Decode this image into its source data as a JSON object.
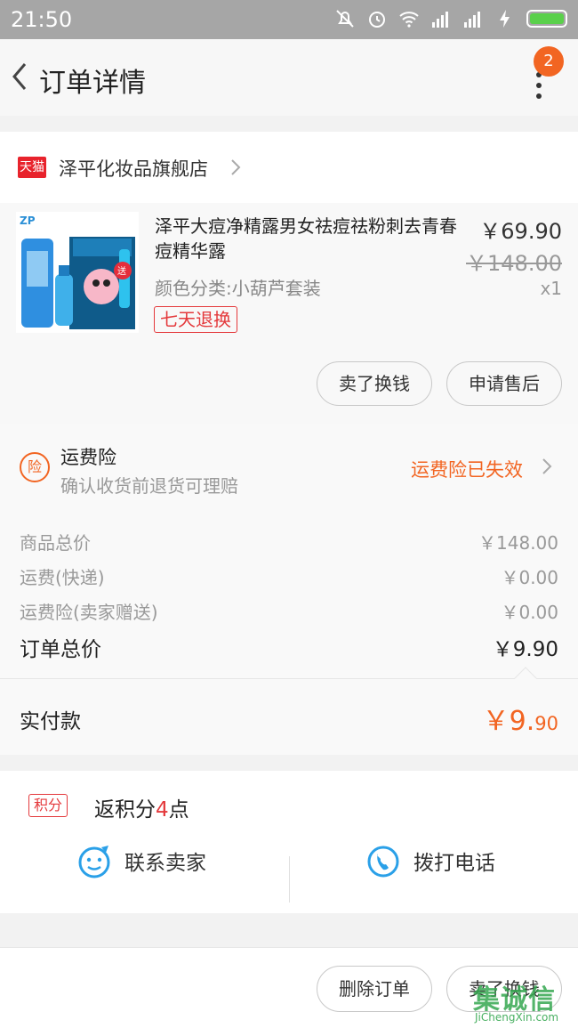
{
  "status_bar": {
    "time": "21:50"
  },
  "nav": {
    "title": "订单详情",
    "badge_count": "2"
  },
  "store": {
    "platform_badge": "天猫",
    "name": "泽平化妆品旗舰店"
  },
  "product": {
    "title": "泽平大痘净精露男女祛痘祛粉刺去青春痘精华露",
    "spec": "颜色分类:小葫芦套装",
    "return_policy": "七天退换",
    "price": "￥69.90",
    "original_price": "￥148.00",
    "quantity": "x1",
    "buttons": {
      "sell": "卖了换钱",
      "after_sale": "申请售后"
    }
  },
  "insurance": {
    "icon_text": "险",
    "title": "运费险",
    "description": "确认收货前退货可理赔",
    "status": "运费险已失效"
  },
  "price_summary": {
    "rows": [
      {
        "label": "商品总价",
        "value": "￥148.00"
      },
      {
        "label": "运费(快递)",
        "value": "￥0.00"
      },
      {
        "label": "运费险(卖家赠送)",
        "value": "￥0.00"
      }
    ],
    "total_label": "订单总价",
    "total_value": "￥9.90"
  },
  "payment": {
    "label": "实付款",
    "value_main": "￥9.",
    "value_decimal": "90"
  },
  "points": {
    "badge": "积分",
    "prefix": "返积分",
    "amount": "4",
    "suffix": "点"
  },
  "contact": {
    "seller_label": "联系卖家",
    "phone_label": "拨打电话"
  },
  "bottom_actions": {
    "delete": "删除订单",
    "sell": "卖了换钱"
  },
  "watermark": {
    "cn": "集诚信",
    "en": "JiChengXin.com"
  },
  "colors": {
    "accent_orange": "#f26522",
    "tmall_red": "#e8232c",
    "contact_blue": "#2aa0e8"
  }
}
